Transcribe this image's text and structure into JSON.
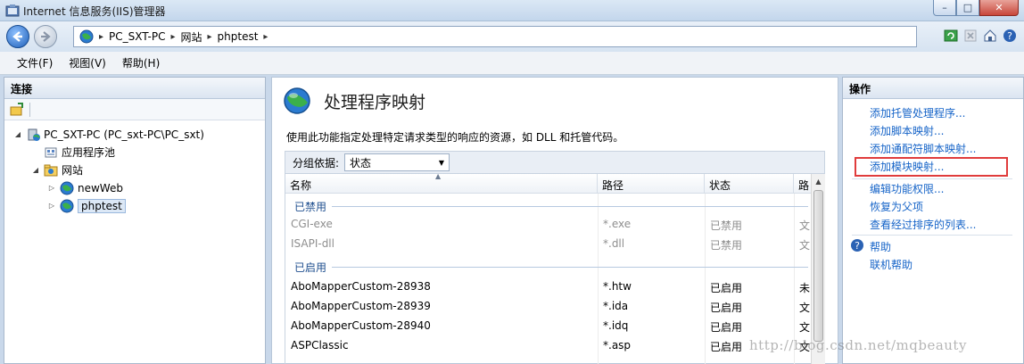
{
  "window": {
    "title": "Internet 信息服务(IIS)管理器",
    "controls": {
      "minimize": "–",
      "maximize": "□",
      "close": "✕"
    }
  },
  "address": {
    "segments": [
      "PC_SXT-PC",
      "网站",
      "phptest"
    ],
    "separator": "▸"
  },
  "menu": [
    "文件(F)",
    "视图(V)",
    "帮助(H)"
  ],
  "connections": {
    "title": "连接",
    "tree": [
      {
        "label": "PC_SXT-PC (PC_sxt-PC\\PC_sxt)",
        "twisty": "◢",
        "icon": "server-icon"
      },
      {
        "label": "应用程序池",
        "twisty": "",
        "icon": "app-pool-icon"
      },
      {
        "label": "网站",
        "twisty": "◢",
        "icon": "sites-folder-icon"
      },
      {
        "label": "newWeb",
        "twisty": "▷",
        "icon": "globe-icon"
      },
      {
        "label": "phptest",
        "twisty": "▷",
        "icon": "globe-icon",
        "selected": true
      }
    ]
  },
  "feature": {
    "title": "处理程序映射",
    "description": "使用此功能指定处理特定请求类型的响应的资源，如 DLL 和托管代码。",
    "group_by_label": "分组依据:",
    "group_by_value": "状态",
    "columns": [
      "名称",
      "路径",
      "状态",
      "路"
    ],
    "groups": [
      {
        "name": "已禁用",
        "rows": [
          {
            "name": "CGI-exe",
            "path": "*.exe",
            "state": "已禁用",
            "extra": "文"
          },
          {
            "name": "ISAPI-dll",
            "path": "*.dll",
            "state": "已禁用",
            "extra": "文"
          }
        ]
      },
      {
        "name": "已启用",
        "rows": [
          {
            "name": "AboMapperCustom-28938",
            "path": "*.htw",
            "state": "已启用",
            "extra": "未"
          },
          {
            "name": "AboMapperCustom-28939",
            "path": "*.ida",
            "state": "已启用",
            "extra": "文"
          },
          {
            "name": "AboMapperCustom-28940",
            "path": "*.idq",
            "state": "已启用",
            "extra": "文"
          },
          {
            "name": "ASPClassic",
            "path": "*.asp",
            "state": "已启用",
            "extra": "文"
          }
        ]
      }
    ]
  },
  "actions": {
    "title": "操作",
    "items": [
      "添加托管处理程序...",
      "添加脚本映射...",
      "添加通配符脚本映射...",
      "添加模块映射...",
      "编辑功能权限...",
      "恢复为父项",
      "查看经过排序的列表..."
    ],
    "help": "帮助",
    "online_help": "联机帮助"
  },
  "watermark": "http://blog.csdn.net/mqbeauty",
  "colors": {
    "link": "#1664c8",
    "highlight_border": "#e03c3c",
    "group_header": "#1f4f8f"
  }
}
